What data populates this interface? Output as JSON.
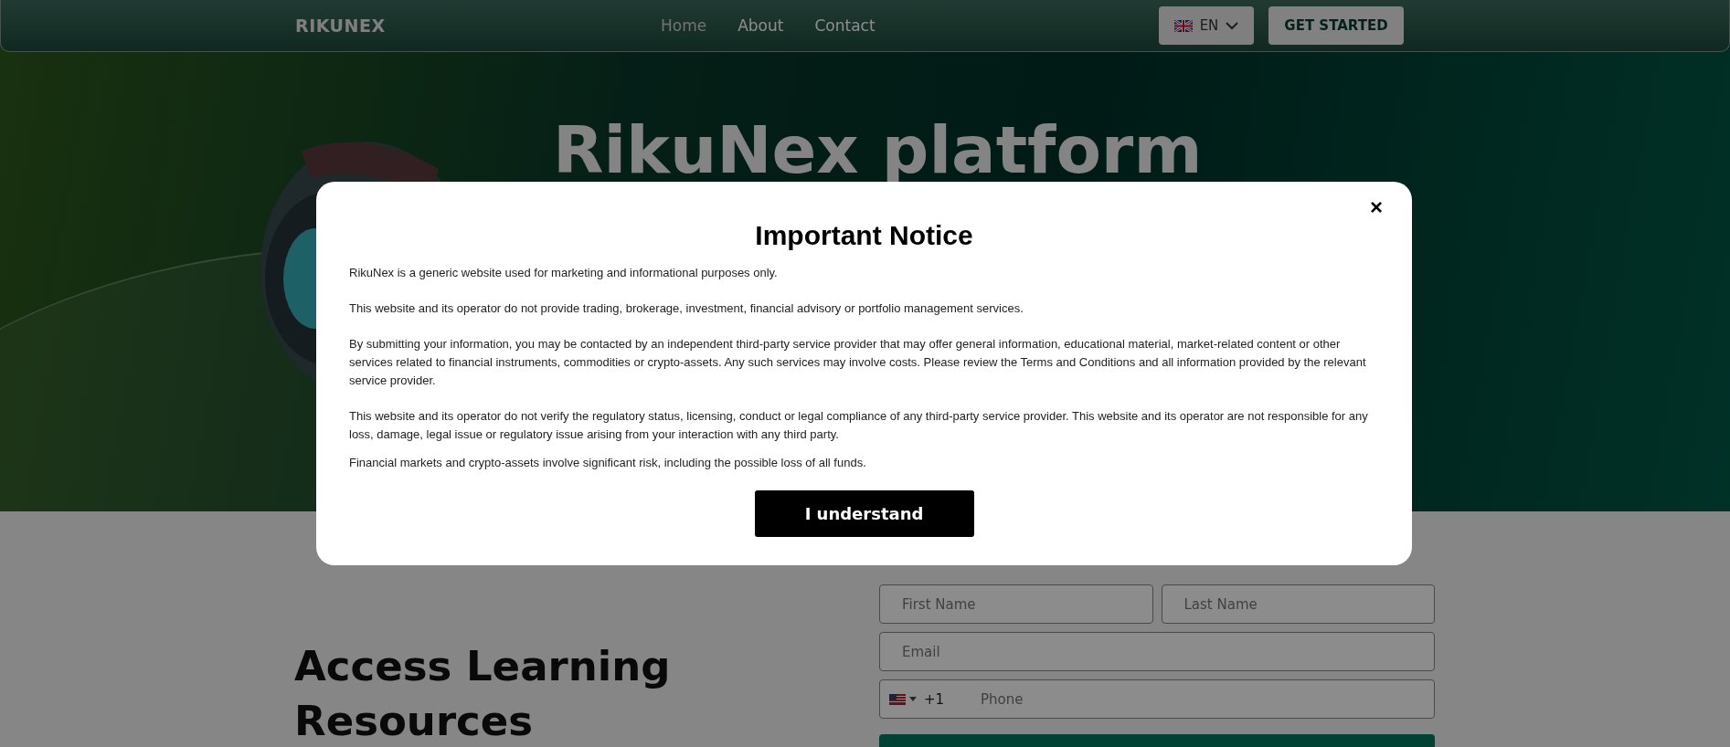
{
  "header": {
    "logo": "RIKUNEX",
    "nav": [
      {
        "label": "Home",
        "selected": true
      },
      {
        "label": "About",
        "selected": false
      },
      {
        "label": "Contact",
        "selected": false
      }
    ],
    "language": "EN",
    "cta": "GET STARTED"
  },
  "hero": {
    "title": "RikuNex platform"
  },
  "section": {
    "heading": "Access Learning Resources"
  },
  "form": {
    "first_name": {
      "placeholder": "First Name"
    },
    "last_name": {
      "placeholder": "Last Name"
    },
    "email": {
      "placeholder": "Email"
    },
    "phone": {
      "country_code": "+1",
      "placeholder": "Phone"
    }
  },
  "modal": {
    "title": "Important Notice",
    "close": "×",
    "paragraphs": [
      "RikuNex is a generic website used for marketing and informational purposes only.",
      "This website and its operator do not provide trading, brokerage, investment, financial advisory or portfolio management services.",
      "By submitting your information, you may be contacted by an independent third-party service provider that may offer general information, educational material, market-related content or other services related to financial instruments, commodities or crypto-assets. Any such services may involve costs. Please review the Terms and Conditions and all information provided by the relevant service provider.",
      "This website and its operator do not verify the regulatory status, licensing, conduct or legal compliance of any third-party service provider. This website and its operator are not responsible for any loss, damage, legal issue or regulatory issue arising from your interaction with any third party.",
      "Financial markets and crypto-assets involve significant risk, including the possible loss of all funds."
    ],
    "button": "I understand"
  }
}
